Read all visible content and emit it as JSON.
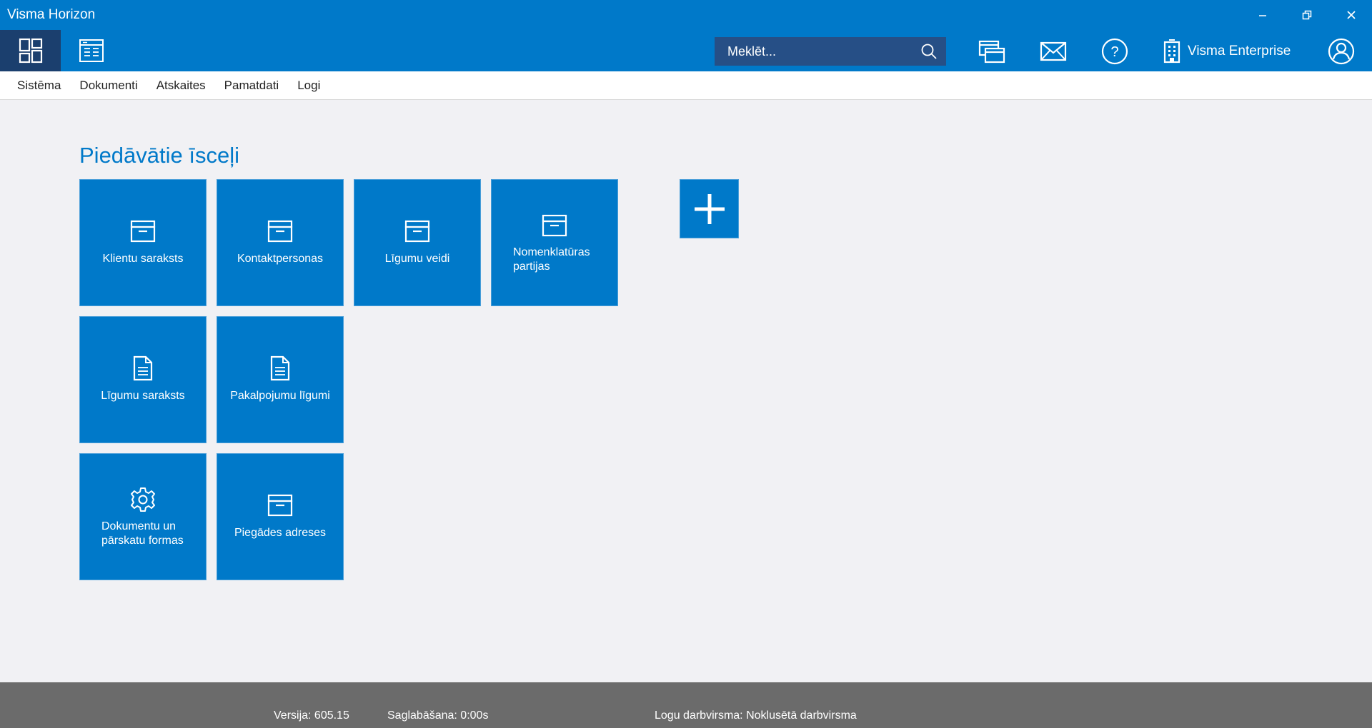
{
  "window": {
    "title": "Visma Horizon"
  },
  "toolbar": {
    "search_placeholder": "Meklēt...",
    "company_name": "Visma Enterprise"
  },
  "menu": [
    "Sistēma",
    "Dokumenti",
    "Atskaites",
    "Pamatdati",
    "Logi"
  ],
  "main": {
    "heading": "Piedāvātie īsceļi",
    "tiles": [
      {
        "label": "Klientu saraksts",
        "icon": "archive-box-icon"
      },
      {
        "label": "Kontaktpersonas",
        "icon": "archive-box-icon"
      },
      {
        "label": "Līgumu veidi",
        "icon": "archive-box-icon"
      },
      {
        "label": "Nomenklatūras\npartijas",
        "icon": "archive-box-icon"
      },
      {
        "label": "Līgumu saraksts",
        "icon": "document-icon"
      },
      {
        "label": "Pakalpojumu līgumi",
        "icon": "document-icon"
      },
      {
        "label": "Dokumentu un\npārskatu formas",
        "icon": "gear-icon"
      },
      {
        "label": "Piegādes adreses",
        "icon": "archive-box-icon"
      }
    ]
  },
  "status": {
    "version": "Versija: 605.15",
    "save": "Saglabāšana: 0:00s",
    "workspace": "Logu darbvirsma: Noklusētā darbvirsma"
  },
  "colors": {
    "brand": "#0079c9",
    "dark_brand": "#1b3f6e",
    "background": "#f1f1f4",
    "statusbar": "#6b6b6b"
  }
}
